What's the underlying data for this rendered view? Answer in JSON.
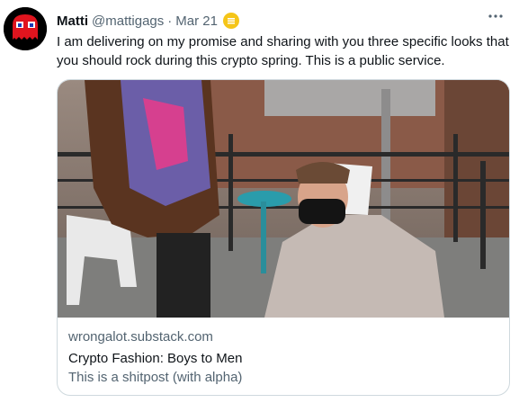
{
  "tweet": {
    "author_name": "Matti",
    "handle": "@mattigags",
    "separator": "·",
    "date": "Mar 21",
    "badge_icon": "coin-badge-icon",
    "more_icon": "more-horizontal-icon",
    "text": "I am delivering on my promise and sharing with you three specific looks that you should rock during this crypto spring. This is a public service."
  },
  "card": {
    "image_icon": "photo-image",
    "domain": "wrongalot.substack.com",
    "title": "Crypto Fashion: Boys to Men",
    "description": "This is a shitpost (with alpha)"
  },
  "colors": {
    "text_primary": "#0f1419",
    "text_secondary": "#536471",
    "border": "#cfd9de",
    "avatar_red": "#e0141e",
    "badge_gold": "#f5c518"
  }
}
